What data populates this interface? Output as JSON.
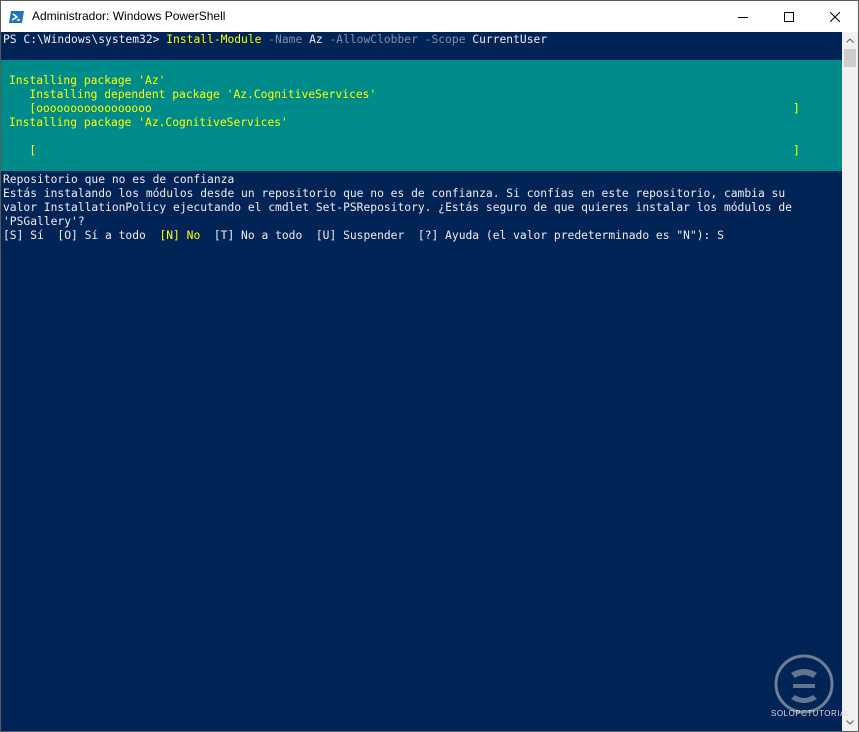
{
  "window": {
    "title": "Administrador: Windows PowerShell",
    "icon": "powershell-icon",
    "controls": {
      "minimize": "minimize-icon",
      "maximize": "maximize-icon",
      "close": "close-icon"
    }
  },
  "console": {
    "prompt": "PS C:\\Windows\\system32> ",
    "command": {
      "cmdlet": "Install-Module",
      "param1": " -Name",
      "value1": " Az",
      "param2": " -AllowClobber",
      "param3": " -Scope",
      "value3": " CurrentUser"
    },
    "progress": {
      "line1": "Installing package 'Az'",
      "line2": "   Installing dependent package 'Az.CognitiveServices'",
      "bar1_fill": "   [ooooooooooooooooo",
      "bar1_end": "]",
      "line3": "Installing package 'Az.CognitiveServices'",
      "bar2_start": "   [",
      "bar2_end": "]"
    },
    "prompt_block": {
      "heading": "Repositorio que no es de confianza",
      "text1": "Estás instalando los módulos desde un repositorio que no es de confianza. Si confías en este repositorio, cambia su",
      "text2": "valor InstallationPolicy ejecutando el cmdlet Set-PSRepository. ¿Estás seguro de que quieres instalar los módulos de",
      "text3": "'PSGallery'?",
      "opt_s": "[S] Sí  [O] Sí a todo  ",
      "opt_n": "[N] No",
      "opt_rest": "  [T] No a todo  [U] Suspender  [?] Ayuda (el valor predeterminado es \"N\"): S"
    }
  },
  "colors": {
    "console_bg": "#012456",
    "progress_bg": "#008b8b",
    "accent_yellow": "#ffff00"
  },
  "watermark": "SOLOPCTUTORIAL"
}
